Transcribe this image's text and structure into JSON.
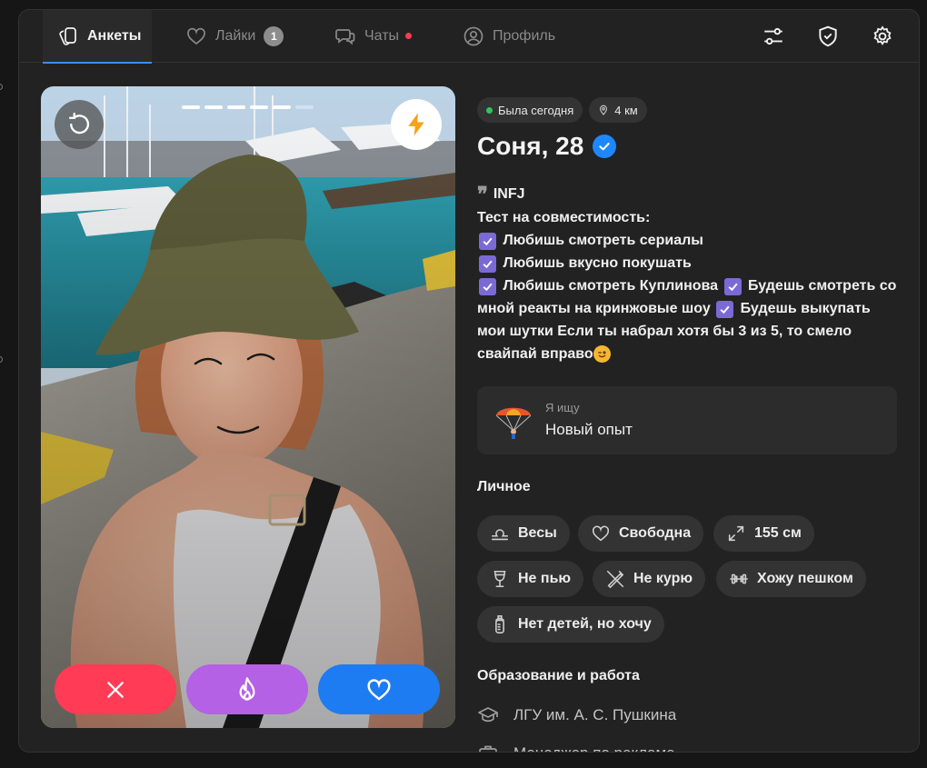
{
  "nav": {
    "tabs": [
      {
        "label": "Анкеты",
        "icon": "cards-icon",
        "active": true
      },
      {
        "label": "Лайки",
        "icon": "heart-icon",
        "badge": "1"
      },
      {
        "label": "Чаты",
        "icon": "chat-icon",
        "dot": true
      },
      {
        "label": "Профиль",
        "icon": "profile-icon"
      }
    ],
    "actions": [
      "filters-icon",
      "shield-icon",
      "settings-icon"
    ]
  },
  "photo": {
    "progress_total": 6,
    "progress_active": 5
  },
  "profile": {
    "status": "Была сегодня",
    "distance": "4 км",
    "name": "Соня, 28",
    "verified": true,
    "bio": {
      "type": "INFJ",
      "intro": "Тест на совместимость:",
      "items": [
        "Любишь смотреть сериалы",
        "Любишь вкусно покушать",
        "Любишь смотреть Куплинова",
        "Будешь смотреть со мной реакты на кринжовые шоу",
        "Будешь выкупать мои шутки"
      ],
      "outro": "Если ты набрал хотя бы 3 из 5, то смело свайпай вправо"
    },
    "looking_for": {
      "label": "Я ищу",
      "value": "Новый опыт"
    },
    "personal_title": "Личное",
    "personal_tags": [
      "Весы",
      "Свободна",
      "155 см",
      "Не пью",
      "Не курю",
      "Хожу пешком",
      "Нет детей, но хочу"
    ],
    "education_title": "Образование и работа",
    "education": [
      "ЛГУ им. А. С. Пушкина",
      "Менеджер по рекламе"
    ]
  },
  "colors": {
    "accent": "#1d7cf2",
    "dislike": "#ff3b55",
    "superlike": "#b461e6",
    "online": "#2fc55d",
    "check": "#7b6ad6"
  }
}
